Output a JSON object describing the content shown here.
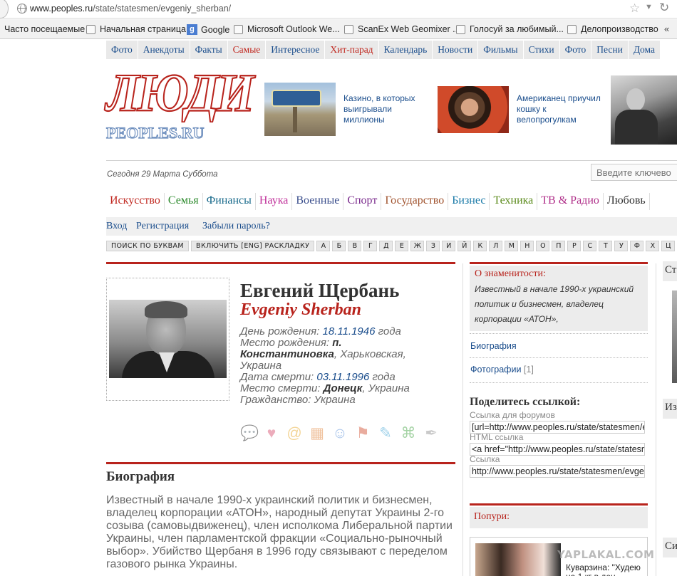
{
  "browser": {
    "url_host": "www.peoples.ru",
    "url_path": "/state/statesmen/evgeniy_sherban/",
    "bookmarks": [
      "Часто посещаемые",
      "Начальная страница",
      "Google",
      "Microsoft Outlook We...",
      "ScanEx Web Geomixer ...",
      "Голосуй за любимый...",
      "Делопроизводство"
    ],
    "more": "«"
  },
  "topnav": [
    "Фото",
    "Анекдоты",
    "Факты",
    "Самые",
    "Интересное",
    "Хит-парад",
    "Календарь",
    "Новости",
    "Фильмы",
    "Стихи",
    "Фото",
    "Песни",
    "Дома"
  ],
  "logo": {
    "big": "ЛЮДИ",
    "small": "PEOPLES.RU"
  },
  "teasers": [
    {
      "text": "Казино, в которых выигрывали миллионы"
    },
    {
      "text": "Американец приучил кошку к велопрогулкам"
    }
  ],
  "today": "Сегодня 29 Марта Суббота",
  "search": {
    "placeholder": "Введите ключево"
  },
  "categories": [
    {
      "label": "Искусство",
      "color": "#c0271f"
    },
    {
      "label": "Семья",
      "color": "#2e8b2e"
    },
    {
      "label": "Финансы",
      "color": "#1a6b8c"
    },
    {
      "label": "Наука",
      "color": "#c0309a"
    },
    {
      "label": "Военные",
      "color": "#3a4e8c"
    },
    {
      "label": "Спорт",
      "color": "#7a2a8c"
    },
    {
      "label": "Государство",
      "color": "#a0522d"
    },
    {
      "label": "Бизнес",
      "color": "#1a7aa8"
    },
    {
      "label": "Техника",
      "color": "#5a8a1a"
    },
    {
      "label": "ТВ & Радио",
      "color": "#b0308a"
    },
    {
      "label": "Любовь",
      "color": "#333333"
    }
  ],
  "login": {
    "enter": "Вход",
    "register": "Регистрация",
    "forgot": "Забыли пароль?"
  },
  "alphabet": {
    "search_by_letter": "ПОИСК ПО БУКВАМ",
    "layout": "ВКЛЮЧИТЬ [ENG] РАСКЛАДКУ",
    "letters": [
      "А",
      "Б",
      "В",
      "Г",
      "Д",
      "Е",
      "Ж",
      "З",
      "И",
      "Й",
      "К",
      "Л",
      "М",
      "Н",
      "О",
      "П",
      "Р",
      "С",
      "Т",
      "У",
      "Ф",
      "Х",
      "Ц"
    ]
  },
  "person": {
    "name_ru": "Евгений Щербань",
    "name_en": "Evgeniy Sherban",
    "birth_label": "День рождения:",
    "birth_date": "18.11.1946",
    "birth_suffix": "года",
    "birthplace_label": "Место рождения:",
    "birthplace": "п. Константиновка",
    "birthplace_rest": ", Харьковская, Украина",
    "death_label": "Дата смерти:",
    "death_date": "03.11.1996",
    "death_suffix": "года",
    "deathplace_label": "Место смерти:",
    "deathplace": "Донецк",
    "deathplace_rest": ", Украина",
    "citizenship": "Гражданство: Украина"
  },
  "bio": {
    "heading": "Биография",
    "text": "Известный в начале 1990-х украинский политик и бизнесмен, владелец корпорации «АТОН», народный депутат Украины 2-го созыва (самовыдвиженец), член исполкома Либеральной партии Украины, член парламентской фракции «Социально-рыночный выбор». Убийство Щербаня в 1996 году связывают с переделом газового рынка Украины."
  },
  "sidebar": {
    "about_title": "О знаменитости:",
    "about_text": "Известный в начале 1990-х украинский политик и бизнесмен, владелец корпорации «АТОН»,",
    "biography": "Биография",
    "photos": "Фотографии",
    "photos_count": "[1]",
    "share_heading": "Поделитесь ссылкой:",
    "forum_label": "Ссылка для форумов",
    "forum_value": "[url=http://www.peoples.ru/state/statesmen/evgeniy_sherban/",
    "html_label": "HTML ссылка",
    "html_value": "<a href=\"http://www.peoples.ru/state/statesmen/evgeniy_sherban/",
    "link_label": "Ссылка",
    "link_value": "http://www.peoples.ru/state/statesmen/evgeniy_sherban/",
    "popuri_title": "Попури:",
    "popuri_text": "Куварзина: \"Худею на 1 кг в ден"
  },
  "far_right": {
    "a": "Ст",
    "b": "Из",
    "c": "Си"
  },
  "watermark": "YAPLAKAL.COM"
}
